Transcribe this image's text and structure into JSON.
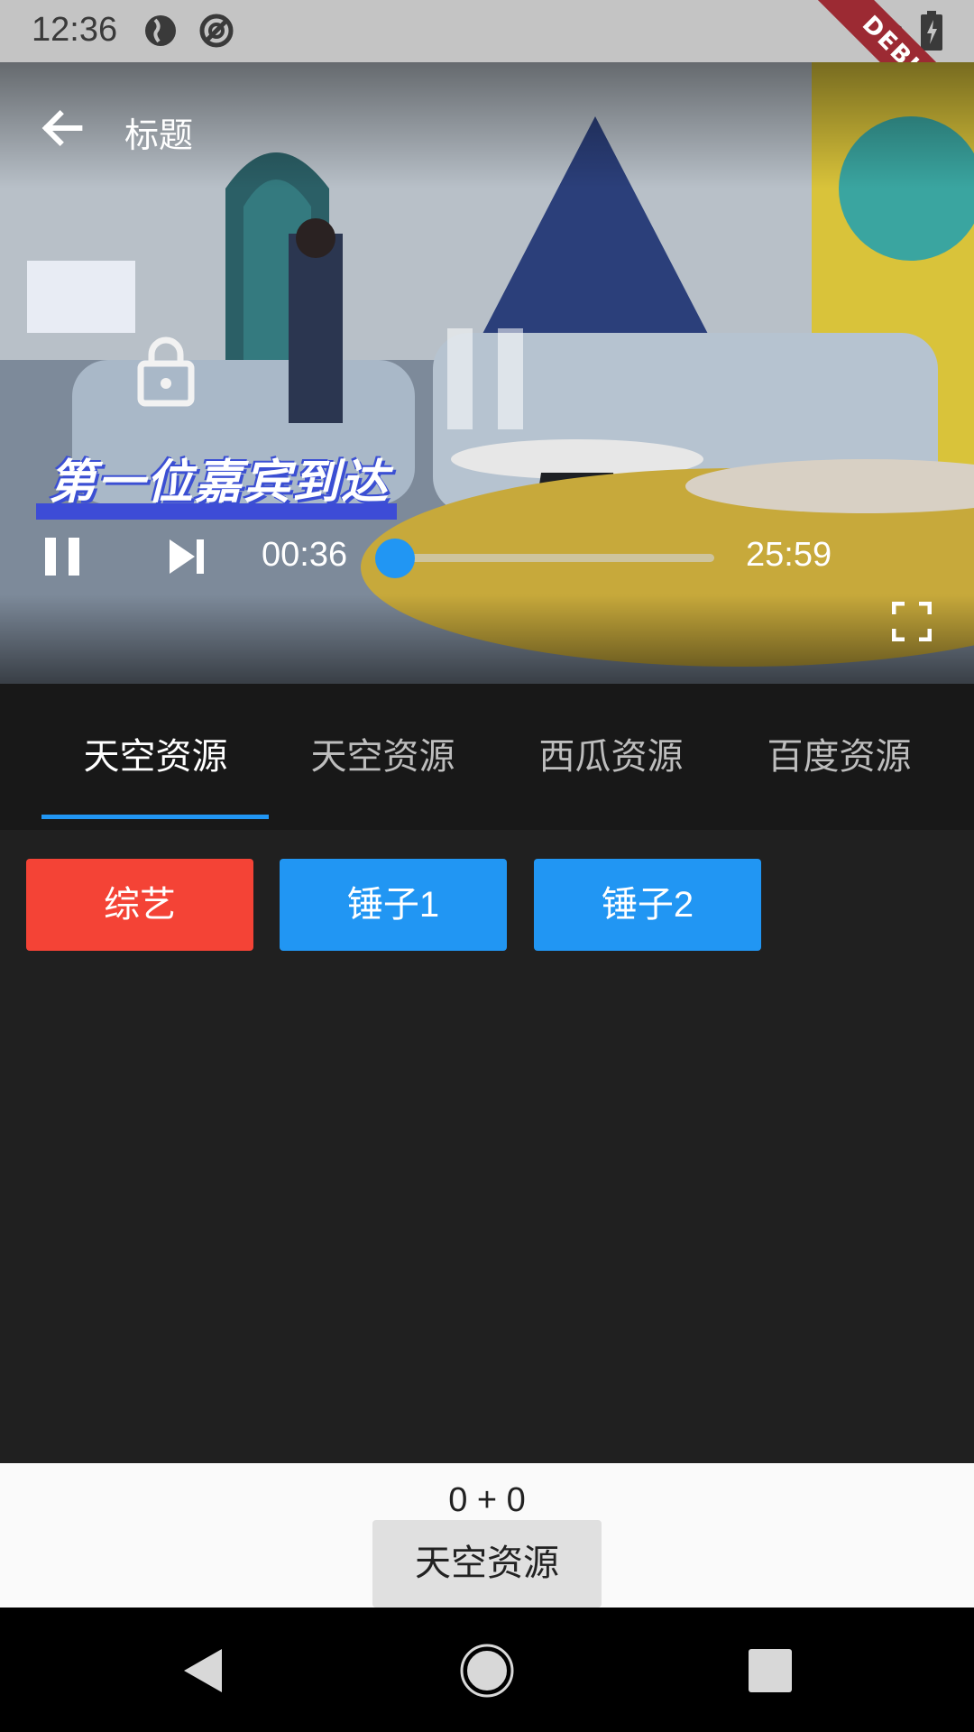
{
  "status_bar": {
    "time": "12:36",
    "debug_label": "DEBUG",
    "icons": [
      "earth-icon",
      "no-disturb-icon",
      "wifi-off-icon",
      "battery-icon"
    ]
  },
  "player": {
    "title": "标题",
    "caption": "第一位嘉宾到达",
    "current_time": "00:36",
    "total_time": "25:59",
    "progress": 0.023,
    "accent_color": "#2196f3",
    "icons": [
      "back-arrow-icon",
      "lock-icon",
      "pause-icon",
      "skip-next-icon",
      "fullscreen-icon"
    ]
  },
  "tabs": [
    {
      "label": "天空资源",
      "active": true
    },
    {
      "label": "天空资源",
      "active": false
    },
    {
      "label": "西瓜资源",
      "active": false
    },
    {
      "label": "百度资源",
      "active": false
    }
  ],
  "chips": [
    {
      "label": "综艺",
      "color": "#f44336"
    },
    {
      "label": "锤子1",
      "color": "#2196f3"
    },
    {
      "label": "锤子2",
      "color": "#2196f3"
    }
  ],
  "bottom": {
    "counter": "0 + 0",
    "source_button": "天空资源"
  },
  "nav_bar": {
    "icons": [
      "back-triangle-icon",
      "home-circle-icon",
      "recents-square-icon"
    ]
  }
}
